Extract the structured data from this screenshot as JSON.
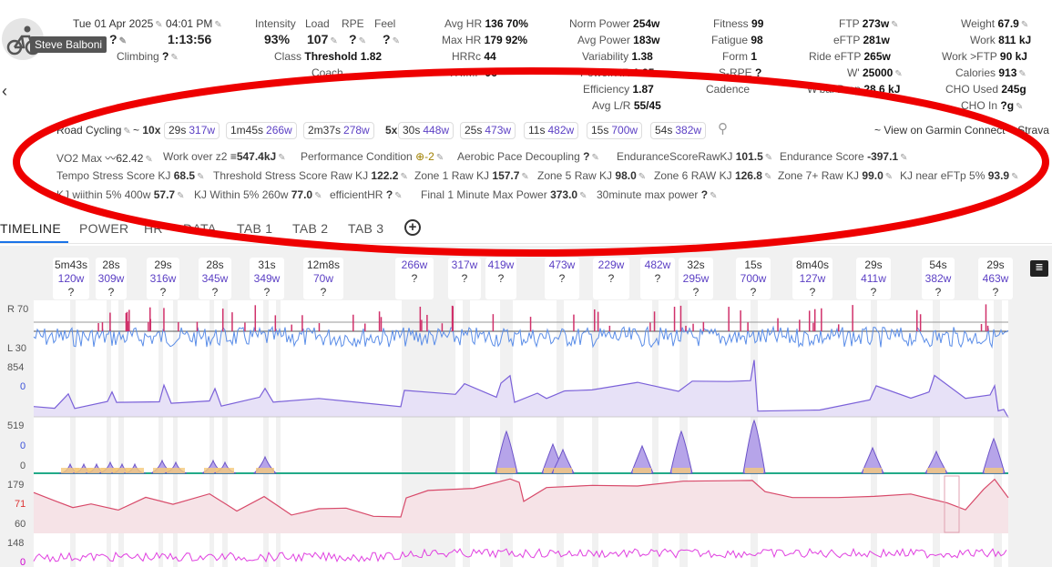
{
  "header": {
    "date": "Tue 01 Apr 2025",
    "time": "04:01 PM",
    "duration": "1:13:56",
    "climbing_label": "Climbing",
    "climbing_value": "?",
    "top_q": "?",
    "athlete_tooltip": "Steve Balboni"
  },
  "col_load": {
    "intensity_label": "Intensity",
    "intensity_value": "93%",
    "load_label": "Load",
    "load_value": "107",
    "rpe_label": "RPE",
    "rpe_value": "?",
    "feel_label": "Feel",
    "feel_value": "?",
    "class_label": "Class",
    "class_value": "Threshold 1.82",
    "coach_label": "Coach"
  },
  "col_hr": {
    "avg_hr_label": "Avg HR",
    "avg_hr_value": "136 70%",
    "max_hr_label": "Max HR",
    "max_hr_value": "179 92%",
    "hrrc_label": "HRRc",
    "hrrc_value": "44",
    "trimp_label": "TRIMP",
    "trimp_value": "96"
  },
  "col_power": {
    "norm_label": "Norm Power",
    "norm_value": "254w",
    "avg_label": "Avg Power",
    "avg_value": "183w",
    "var_label": "Variability",
    "var_value": "1.38",
    "phr_label": "Power/HR",
    "phr_value": "1.35",
    "eff_label": "Efficiency",
    "eff_value": "1.87",
    "lr_label": "Avg L/R",
    "lr_value": "55/45"
  },
  "col_fitness": {
    "fitness_label": "Fitness",
    "fitness_value": "99",
    "fatigue_label": "Fatigue",
    "fatigue_value": "98",
    "form_label": "Form",
    "form_value": "1",
    "srpe_label": "S-RPE",
    "srpe_value": "?",
    "cadence_label": "Cadence"
  },
  "col_ftp": {
    "ftp_label": "FTP",
    "ftp_value": "273w",
    "eftp_label": "eFTP",
    "eftp_value": "281w",
    "ride_eftp_label": "Ride eFTP",
    "ride_eftp_value": "265w",
    "wp_label": "W'",
    "wp_value": "25000",
    "wbal_label": "W'bal Drop",
    "wbal_value": "28.6 kJ"
  },
  "col_weight": {
    "weight_label": "Weight",
    "weight_value": "67.9",
    "work_label": "Work",
    "work_value": "811 kJ",
    "work_ftp_label": "Work >FTP",
    "work_ftp_value": "90 kJ",
    "cal_label": "Calories",
    "cal_value": "913",
    "cho_used_label": "CHO Used",
    "cho_used_value": "245g",
    "cho_in_label": "CHO In",
    "cho_in_value": "?g"
  },
  "intervals": {
    "sport": "Road Cycling",
    "count": "10x",
    "chips": [
      {
        "d": "29s",
        "w": "317w"
      },
      {
        "d": "1m45s",
        "w": "266w"
      },
      {
        "d": "2m37s",
        "w": "278w"
      }
    ],
    "count2": "5x",
    "chips2": [
      {
        "d": "30s",
        "w": "448w"
      },
      {
        "d": "25s",
        "w": "473w"
      },
      {
        "d": "11s",
        "w": "482w"
      },
      {
        "d": "15s",
        "w": "700w"
      },
      {
        "d": "54s",
        "w": "382w"
      }
    ],
    "links": "~ View on Garmin Connect ~ Strava"
  },
  "custom_fields": {
    "vo2_label": "VO2 Max",
    "vo2_value": "62.42",
    "woz2_label": "Work over z2",
    "woz2_value": "547.4kJ",
    "pc_label": "Performance Condition",
    "pc_value": "-2",
    "apd_label": "Aerobic Pace Decoupling",
    "apd_value": "?",
    "esraw_label": "EnduranceScoreRawKJ",
    "esraw_value": "101.5",
    "es_label": "Endurance Score",
    "es_value": "-397.1",
    "tempo_label": "Tempo Stress Score KJ",
    "tempo_value": "68.5",
    "thr_label": "Threshold Stress Score Raw KJ",
    "thr_value": "122.2",
    "z1_label": "Zone 1 Raw KJ",
    "z1_value": "157.7",
    "z5_label": "Zone 5 Raw KJ",
    "z5_value": "98.0",
    "z6_label": "Zone 6 RAW KJ",
    "z6_value": "126.8",
    "z7_label": "Zone 7+ Raw KJ",
    "z7_value": "99.0",
    "kjeftp_label": "KJ near eFTp 5%",
    "kjeftp_value": "93.9",
    "kj400_label": "KJ wiithin 5% 400w",
    "kj400_value": "57.7",
    "kj260_label": "KJ Within 5% 260w",
    "kj260_value": "77.0",
    "ehr_label": "efficientHR",
    "ehr_value": "?",
    "f1m_label": "Final 1 Minute Max Power",
    "f1m_value": "373.0",
    "m30_label": "30minute max power",
    "m30_value": "?"
  },
  "tabs": [
    "TIMELINE",
    "POWER",
    "HR",
    "DATA",
    "TAB 1",
    "TAB 2",
    "TAB 3"
  ],
  "laps": [
    {
      "d": "5m43s",
      "w": "120w",
      "q": "?"
    },
    {
      "d": "28s",
      "w": "309w",
      "q": "?"
    },
    {
      "d": "29s",
      "w": "316w",
      "q": "?"
    },
    {
      "d": "28s",
      "w": "345w",
      "q": "?"
    },
    {
      "d": "31s",
      "w": "349w",
      "q": "?"
    },
    {
      "d": "12m8s",
      "w": "70w",
      "q": "?"
    },
    {
      "d": "",
      "w": "266w",
      "q": "?"
    },
    {
      "d": "",
      "w": "317w",
      "q": "?"
    },
    {
      "d": "",
      "w": "419w",
      "q": "?"
    },
    {
      "d": "",
      "w": "473w",
      "q": "?"
    },
    {
      "d": "",
      "w": "229w",
      "q": "?"
    },
    {
      "d": "",
      "w": "482w",
      "q": "?"
    },
    {
      "d": "32s",
      "w": "295w",
      "q": "?"
    },
    {
      "d": "15s",
      "w": "700w",
      "q": "?"
    },
    {
      "d": "8m40s",
      "w": "127w",
      "q": "?"
    },
    {
      "d": "29s",
      "w": "411w",
      "q": "?"
    },
    {
      "d": "54s",
      "w": "382w",
      "q": "?"
    },
    {
      "d": "29s",
      "w": "463w",
      "q": "?"
    }
  ],
  "axis": {
    "balance_top": "R 70",
    "balance_bottom": "L 30",
    "power_max": "854",
    "power_zero": "0",
    "wbal_max": "519",
    "wbal_zero": "0",
    "wbal_zero2": "0",
    "hr_max": "179",
    "hr_mid": "71",
    "hr_min": "60",
    "cad_max": "148",
    "cad_zero": "0"
  },
  "colors": {
    "power": "#7b61d9",
    "balance": "#5a8de8",
    "balance_spike": "#d0306a",
    "hr": "#d84a6a",
    "cadence": "#e040e0",
    "annotation": "#ee0000"
  }
}
